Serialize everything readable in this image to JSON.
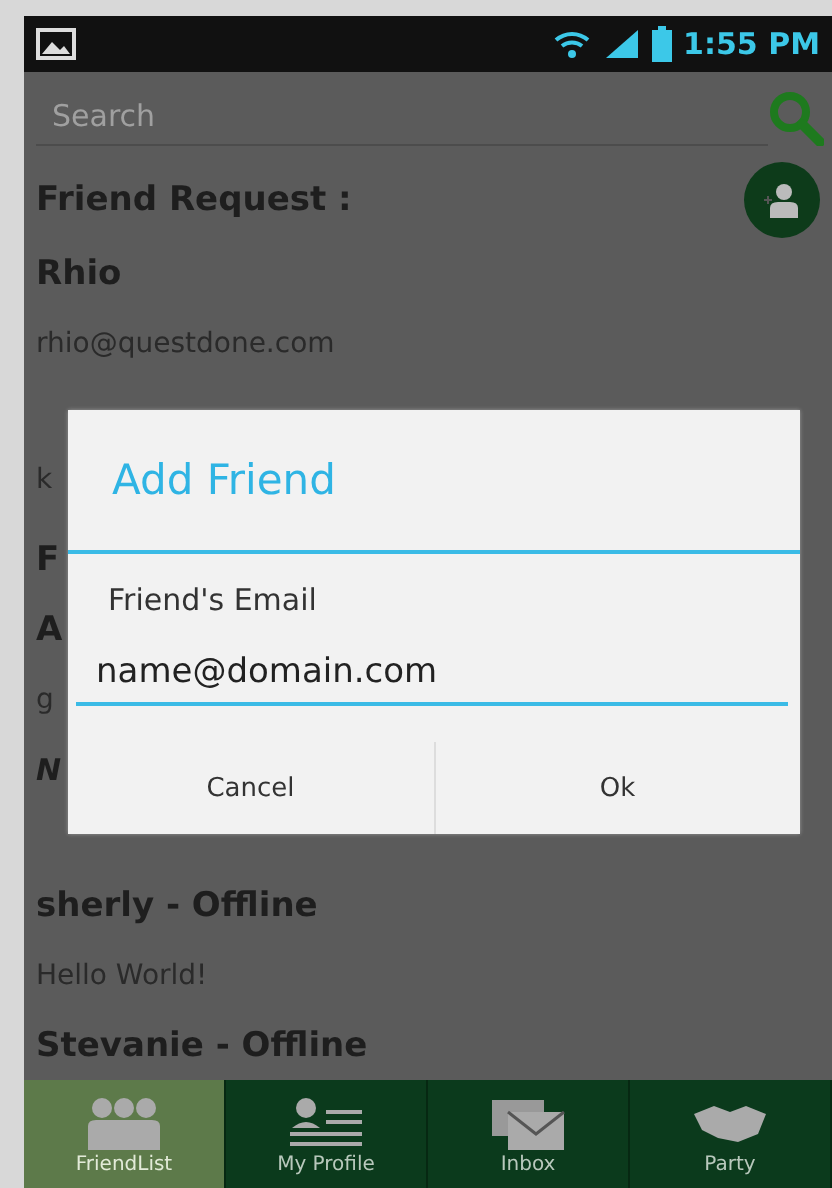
{
  "status_bar": {
    "time": "1:55 PM"
  },
  "search": {
    "placeholder": "Search"
  },
  "section_title": "Friend Request :",
  "list": [
    {
      "kind": "name",
      "text": "Rhio"
    },
    {
      "kind": "detail",
      "text": "rhio@questdone.com"
    },
    {
      "kind": "detail",
      "text": "k"
    },
    {
      "kind": "name",
      "text": "F"
    },
    {
      "kind": "name",
      "text": "A"
    },
    {
      "kind": "detail",
      "text": "g"
    },
    {
      "kind": "italic",
      "text": "N"
    },
    {
      "kind": "name",
      "text": "sherly - Offline"
    },
    {
      "kind": "detail",
      "text": "Hello World!"
    },
    {
      "kind": "name",
      "text": "Stevanie - Offline"
    }
  ],
  "dialog": {
    "title": "Add Friend",
    "field_label": "Friend's Email",
    "field_value": "name@domain.com",
    "buttons": [
      "Cancel",
      "Ok"
    ]
  },
  "tabs": [
    {
      "label": "FriendList",
      "selected": true
    },
    {
      "label": "My Profile",
      "selected": false
    },
    {
      "label": "Inbox",
      "selected": false
    },
    {
      "label": "Party",
      "selected": false
    }
  ]
}
